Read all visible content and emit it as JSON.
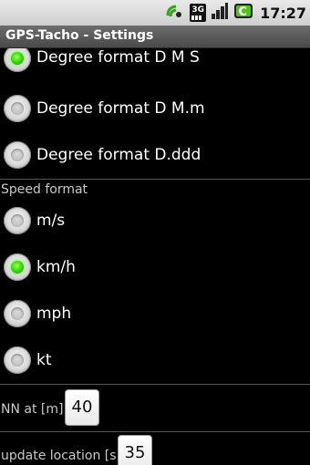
{
  "status_bar": {
    "time": "17:27",
    "network_label": "3G",
    "icons": [
      "sync-icon",
      "3g-icon",
      "signal-icon",
      "battery-charging-icon"
    ]
  },
  "app": {
    "title": "GPS-Tacho - Settings"
  },
  "degree_format": {
    "options": [
      {
        "label": "Degree format D M S",
        "checked": true
      },
      {
        "label": "Degree format D M.m",
        "checked": false
      },
      {
        "label": "Degree format D.ddd",
        "checked": false
      }
    ]
  },
  "speed_format": {
    "title": "Speed format",
    "options": [
      {
        "label": "m/s",
        "checked": false
      },
      {
        "label": "km/h",
        "checked": true
      },
      {
        "label": "mph",
        "checked": false
      },
      {
        "label": "kt",
        "checked": false
      }
    ]
  },
  "nn": {
    "label": "NN at [m]:",
    "value": "40"
  },
  "update_location": {
    "label": "update location [s]:",
    "value": "35"
  },
  "colors": {
    "radio_checked": "#2ed600",
    "background": "#000000",
    "title_bar": "#5a5a5a"
  }
}
